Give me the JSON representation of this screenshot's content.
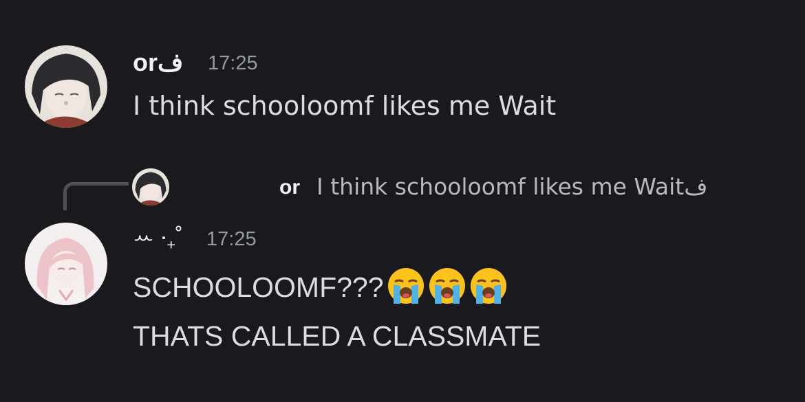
{
  "messages": [
    {
      "username": "orف",
      "timestamp": "17:25",
      "avatar": "dark-haired-anime-avatar",
      "lines": [
        "I think schooloomf likes me Wait"
      ]
    },
    {
      "reply": {
        "username": "or",
        "text": "I think schooloomf likes me Waitف",
        "avatar": "dark-haired-anime-avatar"
      },
      "username": "ꕀ ‧₊˚",
      "timestamp": "17:25",
      "avatar": "pink-haired-anime-avatar",
      "lines": [
        "SCHOOLOOMF???",
        "THATS CALLED A CLASSMATE"
      ],
      "emojis": [
        "loudly-crying-face",
        "loudly-crying-face",
        "loudly-crying-face"
      ]
    }
  ],
  "colors": {
    "background": "#1a1a1e",
    "username": "#f2f3f5",
    "text": "#dbdee1",
    "muted": "#949ba4",
    "reply_line": "#4e5058"
  }
}
